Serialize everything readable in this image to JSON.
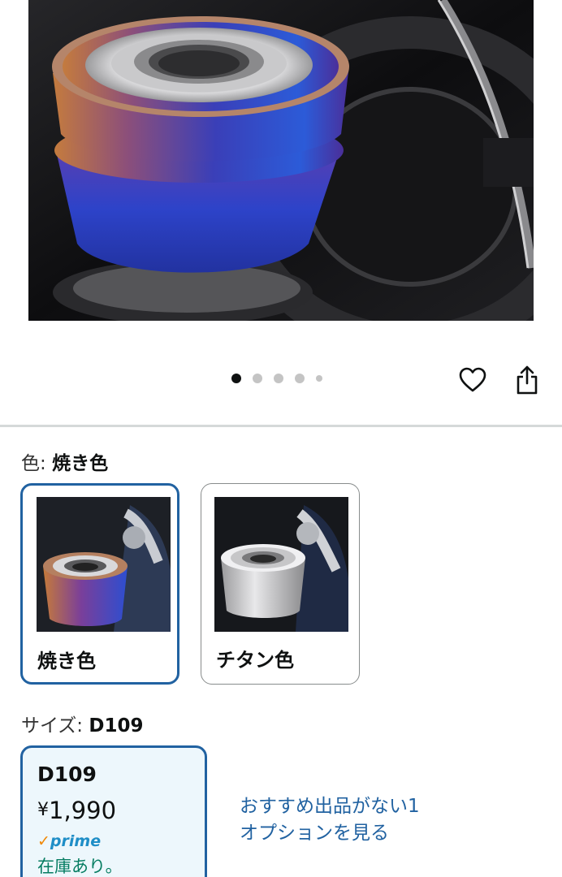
{
  "carousel": {
    "dot_count": 5,
    "active_index": 0
  },
  "icons": {
    "favorite": "heart-icon",
    "share": "share-icon"
  },
  "color_selector": {
    "label": "色:",
    "selected_value": "焼き色",
    "options": [
      {
        "name": "焼き色",
        "selected": true
      },
      {
        "name": "チタン色",
        "selected": false
      }
    ]
  },
  "size_selector": {
    "label": "サイズ:",
    "selected_value": "D109",
    "option": {
      "name": "D109",
      "price_symbol": "¥",
      "price": "1,990",
      "prime_check": "✓",
      "prime_label": "prime",
      "stock": "在庫あり。"
    },
    "see_options_link": "おすすめ出品がない1オプションを見る"
  },
  "colors": {
    "selected_border": "#2162a1",
    "link": "#2162a1",
    "in_stock": "#067d62",
    "prime_blue": "#1f8ec7",
    "prime_check": "#f08804",
    "selected_bg": "#edf7fc"
  }
}
